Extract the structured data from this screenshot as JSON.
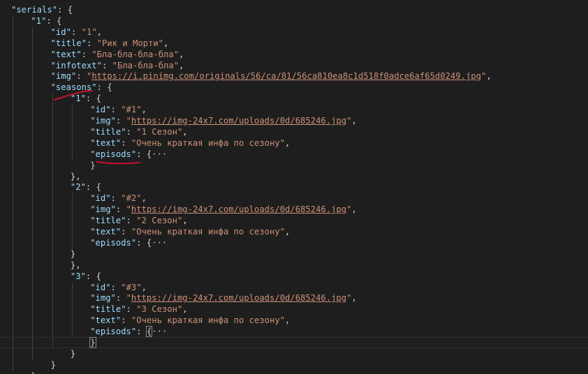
{
  "editor": {
    "lines": [
      {
        "tokens": [
          {
            "t": "\"serials\"",
            "c": "k"
          },
          {
            "t": ": {",
            "c": "p"
          }
        ]
      },
      {
        "tokens": [
          {
            "t": "\"1\"",
            "c": "k"
          },
          {
            "t": ": {",
            "c": "p"
          }
        ]
      },
      {
        "tokens": [
          {
            "t": "\"id\"",
            "c": "k"
          },
          {
            "t": ": ",
            "c": "p"
          },
          {
            "t": "\"1\"",
            "c": "s"
          },
          {
            "t": ",",
            "c": "p"
          }
        ]
      },
      {
        "tokens": [
          {
            "t": "\"title\"",
            "c": "k"
          },
          {
            "t": ": ",
            "c": "p"
          },
          {
            "t": "\"Рик и Морти\"",
            "c": "s"
          },
          {
            "t": ",",
            "c": "p"
          }
        ]
      },
      {
        "tokens": [
          {
            "t": "\"text\"",
            "c": "k"
          },
          {
            "t": ": ",
            "c": "p"
          },
          {
            "t": "\"Бла-бла-бла-бла\"",
            "c": "s"
          },
          {
            "t": ",",
            "c": "p"
          }
        ]
      },
      {
        "tokens": [
          {
            "t": "\"infotext\"",
            "c": "k"
          },
          {
            "t": ": ",
            "c": "p"
          },
          {
            "t": "\"Бла-бла-бла\"",
            "c": "s"
          },
          {
            "t": ",",
            "c": "p"
          }
        ]
      },
      {
        "tokens": [
          {
            "t": "\"img\"",
            "c": "k"
          },
          {
            "t": ": ",
            "c": "p"
          },
          {
            "t": "\"",
            "c": "s"
          },
          {
            "t": "https://i.pinimg.com/originals/56/ca/81/56ca810ea8c1d518f0adce6af65d0249.jpg",
            "c": "u"
          },
          {
            "t": "\"",
            "c": "s"
          },
          {
            "t": ",",
            "c": "p"
          }
        ]
      },
      {
        "tokens": [
          {
            "t": "\"seasons\"",
            "c": "k"
          },
          {
            "t": ": {",
            "c": "p"
          }
        ]
      },
      {
        "tokens": [
          {
            "t": "\"1\"",
            "c": "k"
          },
          {
            "t": ": {",
            "c": "p"
          }
        ]
      },
      {
        "tokens": [
          {
            "t": "\"id\"",
            "c": "k"
          },
          {
            "t": ": ",
            "c": "p"
          },
          {
            "t": "\"#1\"",
            "c": "s"
          },
          {
            "t": ",",
            "c": "p"
          }
        ]
      },
      {
        "tokens": [
          {
            "t": "\"img\"",
            "c": "k"
          },
          {
            "t": ": ",
            "c": "p"
          },
          {
            "t": "\"",
            "c": "s"
          },
          {
            "t": "https://img-24x7.com/uploads/0d/685246.jpg",
            "c": "u"
          },
          {
            "t": "\"",
            "c": "s"
          },
          {
            "t": ",",
            "c": "p"
          }
        ]
      },
      {
        "tokens": [
          {
            "t": "\"title\"",
            "c": "k"
          },
          {
            "t": ": ",
            "c": "p"
          },
          {
            "t": "\"1 Сезон\"",
            "c": "s"
          },
          {
            "t": ",",
            "c": "p"
          }
        ]
      },
      {
        "tokens": [
          {
            "t": "\"text\"",
            "c": "k"
          },
          {
            "t": ": ",
            "c": "p"
          },
          {
            "t": "\"Очень краткая инфа по сезону\"",
            "c": "s"
          },
          {
            "t": ",",
            "c": "p"
          }
        ]
      },
      {
        "tokens": [
          {
            "t": "\"episods\"",
            "c": "k"
          },
          {
            "t": ": {",
            "c": "p"
          },
          {
            "t": "···",
            "c": "fold"
          }
        ]
      },
      {
        "tokens": [
          {
            "t": "}",
            "c": "p"
          }
        ]
      },
      {
        "tokens": [
          {
            "t": "},",
            "c": "p"
          }
        ]
      },
      {
        "tokens": [
          {
            "t": "\"2\"",
            "c": "k"
          },
          {
            "t": ": {",
            "c": "p"
          }
        ]
      },
      {
        "tokens": [
          {
            "t": "\"id\"",
            "c": "k"
          },
          {
            "t": ": ",
            "c": "p"
          },
          {
            "t": "\"#2\"",
            "c": "s"
          },
          {
            "t": ",",
            "c": "p"
          }
        ]
      },
      {
        "tokens": [
          {
            "t": "\"img\"",
            "c": "k"
          },
          {
            "t": ": ",
            "c": "p"
          },
          {
            "t": "\"",
            "c": "s"
          },
          {
            "t": "https://img-24x7.com/uploads/0d/685246.jpg",
            "c": "u"
          },
          {
            "t": "\"",
            "c": "s"
          },
          {
            "t": ",",
            "c": "p"
          }
        ]
      },
      {
        "tokens": [
          {
            "t": "\"title\"",
            "c": "k"
          },
          {
            "t": ": ",
            "c": "p"
          },
          {
            "t": "\"2 Сезон\"",
            "c": "s"
          },
          {
            "t": ",",
            "c": "p"
          }
        ]
      },
      {
        "tokens": [
          {
            "t": "\"text\"",
            "c": "k"
          },
          {
            "t": ": ",
            "c": "p"
          },
          {
            "t": "\"Очень краткая инфа по сезону\"",
            "c": "s"
          },
          {
            "t": ",",
            "c": "p"
          }
        ]
      },
      {
        "tokens": [
          {
            "t": "\"episods\"",
            "c": "k"
          },
          {
            "t": ": {",
            "c": "p"
          },
          {
            "t": "···",
            "c": "fold"
          }
        ]
      },
      {
        "tokens": [
          {
            "t": "}",
            "c": "p"
          }
        ]
      },
      {
        "tokens": [
          {
            "t": "},",
            "c": "p"
          }
        ]
      },
      {
        "tokens": [
          {
            "t": "\"3\"",
            "c": "k"
          },
          {
            "t": ": {",
            "c": "p"
          }
        ]
      },
      {
        "tokens": [
          {
            "t": "\"id\"",
            "c": "k"
          },
          {
            "t": ": ",
            "c": "p"
          },
          {
            "t": "\"#3\"",
            "c": "s"
          },
          {
            "t": ",",
            "c": "p"
          }
        ]
      },
      {
        "tokens": [
          {
            "t": "\"img\"",
            "c": "k"
          },
          {
            "t": ": ",
            "c": "p"
          },
          {
            "t": "\"",
            "c": "s"
          },
          {
            "t": "https://img-24x7.com/uploads/0d/685246.jpg",
            "c": "u"
          },
          {
            "t": "\"",
            "c": "s"
          },
          {
            "t": ",",
            "c": "p"
          }
        ]
      },
      {
        "tokens": [
          {
            "t": "\"title\"",
            "c": "k"
          },
          {
            "t": ": ",
            "c": "p"
          },
          {
            "t": "\"3 Сезон\"",
            "c": "s"
          },
          {
            "t": ",",
            "c": "p"
          }
        ]
      },
      {
        "tokens": [
          {
            "t": "\"text\"",
            "c": "k"
          },
          {
            "t": ": ",
            "c": "p"
          },
          {
            "t": "\"Очень краткая инфа по сезону\"",
            "c": "s"
          },
          {
            "t": ",",
            "c": "p"
          }
        ]
      },
      {
        "tokens": [
          {
            "t": "\"episods\"",
            "c": "k"
          },
          {
            "t": ": ",
            "c": "p"
          },
          {
            "t": "{",
            "c": "p",
            "box": true
          },
          {
            "t": "···",
            "c": "fold"
          }
        ]
      },
      {
        "tokens": [
          {
            "t": "}",
            "c": "p",
            "box": true
          }
        ]
      },
      {
        "tokens": [
          {
            "t": "}",
            "c": "p"
          }
        ]
      },
      {
        "tokens": [
          {
            "t": "}",
            "c": "p"
          }
        ]
      },
      {
        "tokens": [
          {
            "t": "},",
            "c": "p"
          }
        ]
      }
    ]
  },
  "colors": {
    "background": "#1e1e1e",
    "key": "#9cdcfe",
    "string": "#ce9178",
    "punctuation": "#d4d4d4",
    "annotation": "#c8102e"
  }
}
